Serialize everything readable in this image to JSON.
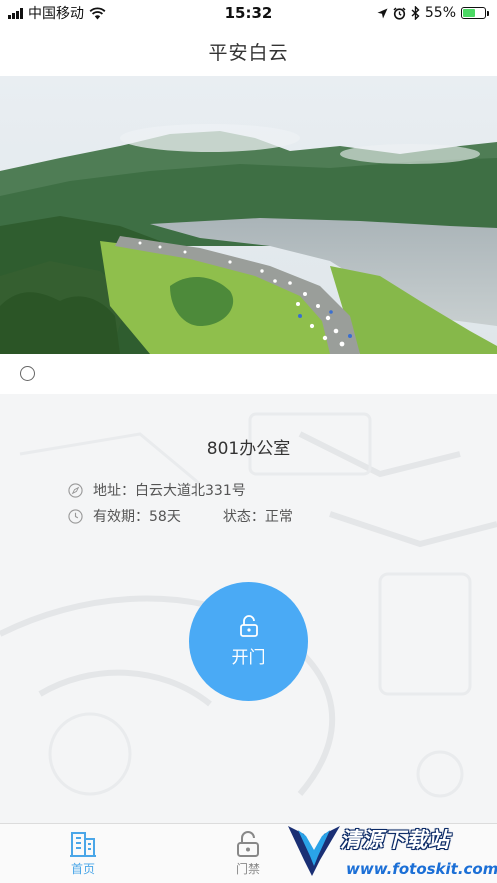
{
  "status_bar": {
    "carrier": "中国移动",
    "time": "15:32",
    "battery": "55%",
    "battery_level": 0.55,
    "icons": [
      "signal-icon",
      "wifi-icon",
      "location-icon",
      "alarm-icon",
      "bluetooth-icon",
      "battery-icon"
    ]
  },
  "nav": {
    "title": "平安白云"
  },
  "banner": {
    "slide_count": 1,
    "active_index": 0
  },
  "card": {
    "room_name": "801办公室",
    "address_label": "地址：",
    "address_value": "白云大道北331号",
    "validity_label": "有效期：",
    "validity_value": "58天",
    "status_label": "状态：",
    "status_value": "正常",
    "open_button_label": "开门"
  },
  "tabs": [
    {
      "label": "首页",
      "icon": "building-icon",
      "active": true
    },
    {
      "label": "门禁",
      "icon": "lock-icon",
      "active": false
    }
  ],
  "watermark": {
    "title": "清源下载站",
    "url": "www.fotoskit.com"
  },
  "colors": {
    "accent": "#4aaaf5",
    "tab_active": "#4aa6e8",
    "tab_inactive": "#888888"
  }
}
